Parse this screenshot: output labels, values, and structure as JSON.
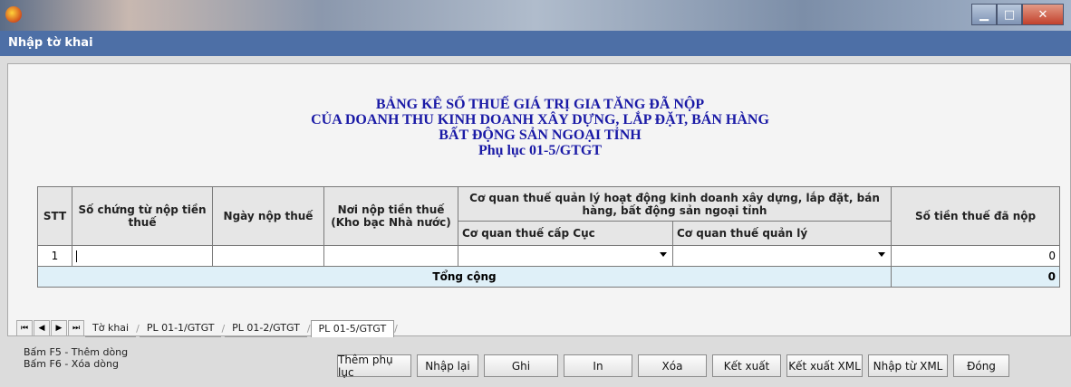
{
  "window": {
    "subtitle": "Nhập tờ khai"
  },
  "heading": {
    "line1": "BẢNG KÊ SỐ THUẾ GIÁ TRỊ GIA TĂNG ĐÃ NỘP",
    "line2": "CỦA DOANH THU KINH DOANH XÂY DỰNG, LẮP ĐẶT, BÁN HÀNG",
    "line3": "BẤT ĐỘNG SẢN NGOẠI TỈNH",
    "line4": "Phụ lục 01-5/GTGT"
  },
  "table": {
    "headers": {
      "stt": "STT",
      "so_chung_tu": "Số chứng từ nộp tiền thuế",
      "ngay_nop": "Ngày nộp thuế",
      "noi_nop": "Nơi nộp tiền thuế (Kho bạc Nhà nước)",
      "co_quan_group": "Cơ quan thuế quản lý hoạt động kinh doanh xây dựng, lắp đặt, bán hàng, bất động sản ngoại tỉnh",
      "cq_cap_cuc": "Cơ quan thuế cấp Cục",
      "cq_quan_ly": "Cơ quan thuế quản lý",
      "so_tien": "Số tiền thuế đã nộp"
    },
    "rows": [
      {
        "stt": "1",
        "so_chung_tu": "",
        "ngay_nop": "",
        "noi_nop": "",
        "cq_cap_cuc": "",
        "cq_quan_ly": "",
        "so_tien": "0"
      }
    ],
    "total_label": "Tổng cộng",
    "total_value": "0"
  },
  "tabs": {
    "items": [
      "Tờ khai",
      "PL 01-1/GTGT",
      "PL 01-2/GTGT",
      "PL 01-5/GTGT"
    ],
    "active": "PL 01-5/GTGT"
  },
  "hints": {
    "line1": "Bấm F5 - Thêm dòng",
    "line2": "Bấm F6 - Xóa dòng"
  },
  "buttons": {
    "them_phu_luc": "Thêm phụ lục",
    "nhap_lai": "Nhập lại",
    "ghi": "Ghi",
    "in": "In",
    "xoa": "Xóa",
    "ket_xuat": "Kết xuất",
    "ket_xuat_xml": "Kết xuất XML",
    "nhap_tu_xml": "Nhập từ XML",
    "dong": "Đóng"
  }
}
